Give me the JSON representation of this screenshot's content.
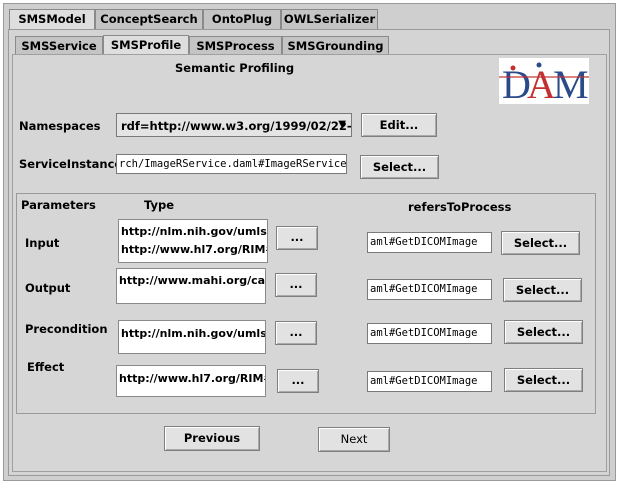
{
  "top_tabs": [
    "SMSModel",
    "ConceptSearch",
    "OntoPlug",
    "OWLSerializer"
  ],
  "sub_tabs": [
    "SMSService",
    "SMSProfile",
    "SMSProcess",
    "SMSGrounding"
  ],
  "heading": "Semantic Profiling",
  "logo_text": "DAML",
  "namespaces": {
    "label": "Namespaces",
    "value": "rdf=http://www.w3.org/1999/02/22-...",
    "edit_label": "Edit..."
  },
  "service_instance": {
    "label": "ServiceInstance",
    "value": "rch/ImageRService.daml#ImageRService",
    "select_label": "Select..."
  },
  "params": {
    "col_parameters": "Parameters",
    "col_type": "Type",
    "col_refers": "refersToProcess",
    "rows": [
      {
        "label": "Input",
        "types": [
          "http://nlm.nih.gov/umls#...",
          "http://www.hl7.org/RIM#..."
        ],
        "more": "...",
        "refers": "aml#GetDICOMImage",
        "select": "Select..."
      },
      {
        "label": "Output",
        "types": [
          "http://www.mahi.org/ca..."
        ],
        "more": "...",
        "refers": "aml#GetDICOMImage",
        "select": "Select..."
      },
      {
        "label": "Precondition",
        "types": [
          "http://nlm.nih.gov/umls#..."
        ],
        "more": "...",
        "refers": "aml#GetDICOMImage",
        "select": "Select..."
      },
      {
        "label": "Effect",
        "types": [
          "http://www.hl7.org/RIM#..."
        ],
        "more": "...",
        "refers": "aml#GetDICOMImage",
        "select": "Select..."
      }
    ]
  },
  "nav": {
    "previous": "Previous",
    "next": "Next"
  }
}
